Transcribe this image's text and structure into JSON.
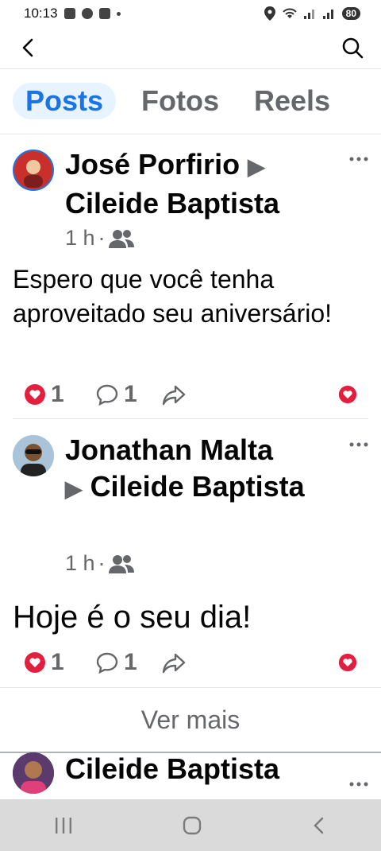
{
  "status_bar": {
    "time": "10:13",
    "battery": "80"
  },
  "tabs": [
    {
      "label": "Posts",
      "active": true
    },
    {
      "label": "Fotos",
      "active": false
    },
    {
      "label": "Reels",
      "active": false
    }
  ],
  "posts": [
    {
      "author": "José Porfirio",
      "recipient": "Cileide Baptista",
      "time": "1 h",
      "separator": "·",
      "text": "Espero que você tenha aproveitado seu aniversário!",
      "reactions": "1",
      "comments": "1"
    },
    {
      "author": "Jonathan Malta",
      "recipient": "Cileide Baptista",
      "time": "1 h",
      "separator": "·",
      "text": "Hoje é o seu dia!",
      "reactions": "1",
      "comments": "1"
    }
  ],
  "ver_mais": "Ver mais",
  "partial_post": {
    "author": "Cileide Baptista"
  },
  "colors": {
    "accent": "#1b74e4",
    "love_red": "#e41e3f"
  }
}
